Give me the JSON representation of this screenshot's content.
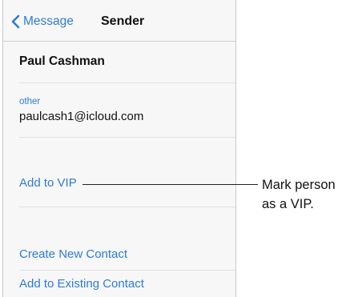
{
  "nav": {
    "back_label": "Message",
    "title": "Sender",
    "back_icon": "chevron-left-icon"
  },
  "sender": {
    "name": "Paul Cashman",
    "email_label": "other",
    "email": "paulcash1@icloud.com"
  },
  "actions": {
    "add_vip": "Add to VIP",
    "create_contact": "Create New Contact",
    "add_existing": "Add to Existing Contact"
  },
  "callout": {
    "line1": "Mark person",
    "line2": "as a VIP."
  },
  "colors": {
    "accent": "#2f7bd8",
    "background": "#f7f7f7",
    "text": "#111111",
    "separator": "#e2e2e2"
  }
}
